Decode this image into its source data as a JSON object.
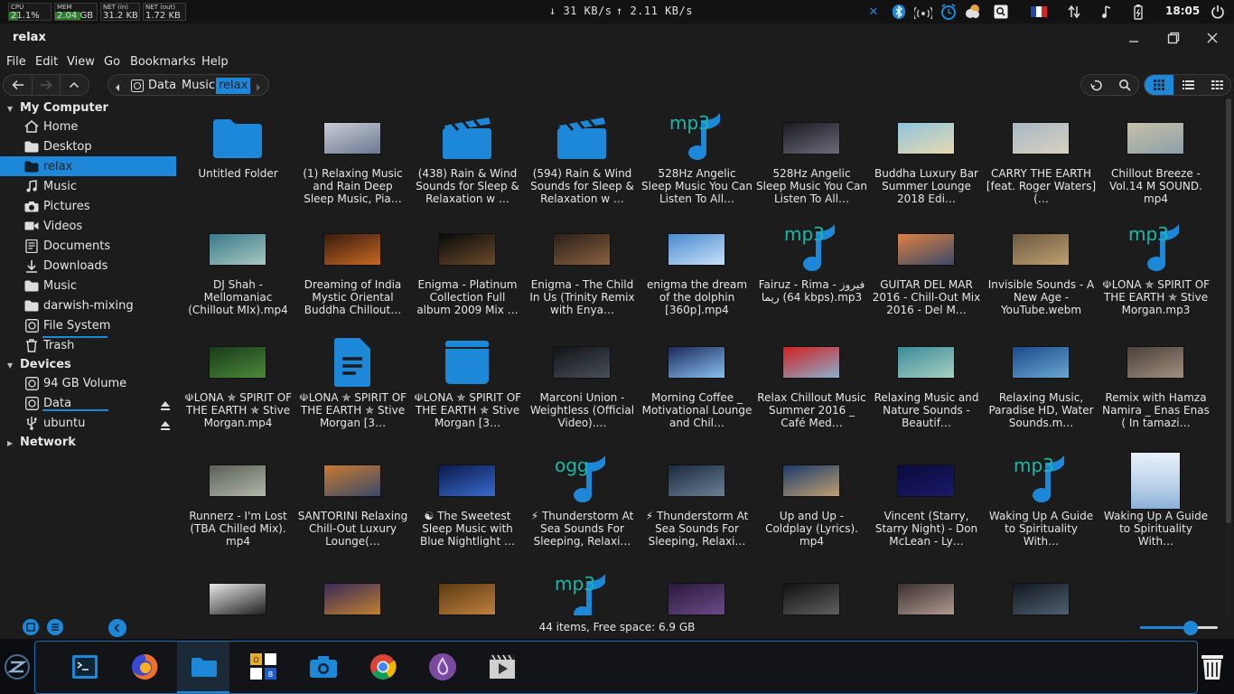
{
  "panel": {
    "cpu": {
      "label": "CPU",
      "value": "21.1%",
      "fill": 0.211
    },
    "mem": {
      "label": "MEM",
      "value": "2.04 GB",
      "fill": 0.6
    },
    "net_in": {
      "label": "NET (in)",
      "value": "31.2 KB"
    },
    "net_out": {
      "label": "NET (out)",
      "value": "1.72 KB"
    },
    "down_speed": "↓  31 KB/s",
    "up_speed": "↑ 2.11 KB/s",
    "clock": "18:05"
  },
  "window": {
    "title": "relax"
  },
  "menu": [
    "File",
    "Edit",
    "View",
    "Go",
    "Bookmarks",
    "Help"
  ],
  "breadcrumb": [
    "Data",
    "Music",
    "relax"
  ],
  "sidebar": {
    "computer_header": "My Computer",
    "computer": [
      {
        "label": "Home",
        "icon": "home-icon"
      },
      {
        "label": "Desktop",
        "icon": "folder-icon"
      },
      {
        "label": "relax",
        "icon": "folder-icon",
        "selected": true
      },
      {
        "label": "Music",
        "icon": "music-icon"
      },
      {
        "label": "Pictures",
        "icon": "camera-icon"
      },
      {
        "label": "Videos",
        "icon": "video-icon"
      },
      {
        "label": "Documents",
        "icon": "document-icon"
      },
      {
        "label": "Downloads",
        "icon": "download-icon"
      },
      {
        "label": "Music",
        "icon": "folder-icon"
      },
      {
        "label": "darwish-mixing",
        "icon": "folder-icon"
      },
      {
        "label": "File System",
        "icon": "drive-icon"
      },
      {
        "label": "Trash",
        "icon": "trash-icon"
      }
    ],
    "devices_header": "Devices",
    "devices": [
      {
        "label": "94 GB Volume",
        "icon": "drive-icon"
      },
      {
        "label": "Data",
        "icon": "drive-icon"
      },
      {
        "label": "ubuntu",
        "icon": "usb-icon"
      }
    ],
    "network_header": "Network"
  },
  "files": [
    {
      "name": "Untitled Folder",
      "type": "folder"
    },
    {
      "name": "(1) Relaxing Music and Rain Deep Sleep Music, Pia…",
      "type": "photo",
      "colors": [
        "#c8ccd6",
        "#6c7890"
      ]
    },
    {
      "name": "(438) Rain & Wind Sounds for Sleep & Relaxation w …",
      "type": "video"
    },
    {
      "name": "(594) Rain & Wind Sounds for Sleep & Relaxation w …",
      "type": "video"
    },
    {
      "name": "528Hz Angelic Sleep Music You Can Listen To All…",
      "type": "audio",
      "ext": "mp3"
    },
    {
      "name": "528Hz Angelic Sleep Music You Can Listen To All…",
      "type": "photo",
      "colors": [
        "#1a1a22",
        "#6c6c7a"
      ]
    },
    {
      "name": "Buddha Luxury Bar Summer Lounge 2018 Edi…",
      "type": "photo",
      "colors": [
        "#8ec4dc",
        "#e8d8b0"
      ]
    },
    {
      "name": "CARRY THE EARTH [feat. Roger Waters] (…",
      "type": "photo",
      "colors": [
        "#a8b8c4",
        "#d8d0c0"
      ]
    },
    {
      "name": "Chillout Breeze - Vol.14 M SOUND. mp4",
      "type": "photo",
      "colors": [
        "#c8c0a8",
        "#8aa0a8"
      ]
    },
    {
      "name": "DJ Shah - Mellomaniac (Chillout MIx).mp4",
      "type": "photo",
      "colors": [
        "#3a7a8a",
        "#a8c8c0"
      ]
    },
    {
      "name": "Dreaming of India Mystic Oriental Buddha Chillout…",
      "type": "photo",
      "colors": [
        "#3a1a10",
        "#c86a20"
      ]
    },
    {
      "name": "Enigma - Platinum Collection Full album 2009 Mix …",
      "type": "photo",
      "colors": [
        "#0a0a0a",
        "#6a4a2a"
      ]
    },
    {
      "name": "Enigma - The Child In Us (Trinity Remix with Enya…",
      "type": "photo",
      "colors": [
        "#2a2018",
        "#8a6040"
      ]
    },
    {
      "name": "enigma the dream of the dolphin [360p].mp4",
      "type": "photo",
      "colors": [
        "#4a8ad0",
        "#c8e0f8"
      ]
    },
    {
      "name": "Fairuz - Rima فيروز - ريما (64 kbps).mp3",
      "type": "audio",
      "ext": "mp3"
    },
    {
      "name": "GUITAR DEL MAR 2016 - Chill-Out Mix 2016 - Del M…",
      "type": "photo",
      "colors": [
        "#e08040",
        "#3a4a6a"
      ]
    },
    {
      "name": "Invisible Sounds - A New Age - YouTube.webm",
      "type": "photo",
      "colors": [
        "#6a5a40",
        "#c0a070"
      ]
    },
    {
      "name": "☫LONA ✯ SPIRIT OF THE EARTH ✯ Stive Morgan.mp3",
      "type": "audio",
      "ext": "mp3"
    },
    {
      "name": "☫LONA ✯ SPIRIT OF THE EARTH ✯ Stive Morgan.mp4",
      "type": "photo",
      "colors": [
        "#1a3a1a",
        "#4a8a3a"
      ]
    },
    {
      "name": "☫LONA ✯ SPIRIT OF THE EARTH ✯ Stive Morgan [3…",
      "type": "text"
    },
    {
      "name": "☫LONA ✯ SPIRIT OF THE EARTH ✯ Stive Morgan [3…",
      "type": "generic"
    },
    {
      "name": "Marconi Union - Weightless (Official Video).…",
      "type": "photo",
      "colors": [
        "#101418",
        "#4a5058"
      ]
    },
    {
      "name": "Morning Coffee _ Motivational Lounge and Chil…",
      "type": "photo",
      "colors": [
        "#1a2a5a",
        "#8ac0f0"
      ]
    },
    {
      "name": "Relax Chillout Music Summer 2016 _ Café Med…",
      "type": "photo",
      "colors": [
        "#d02020",
        "#8ab0d0"
      ]
    },
    {
      "name": "Relaxing Music and Nature Sounds - Beautif…",
      "type": "photo",
      "colors": [
        "#3a8a9a",
        "#a8d0c0"
      ]
    },
    {
      "name": "Relaxing Music, Paradise HD, Water Sounds.m…",
      "type": "photo",
      "colors": [
        "#1a4a8a",
        "#6aa8d0"
      ]
    },
    {
      "name": "Remix with Hamza Namira _ Enas Enas ( In tamazi…",
      "type": "photo",
      "colors": [
        "#4a4038",
        "#a09080"
      ]
    },
    {
      "name": "Runnerz - I'm Lost (TBA Chilled Mix). mp4",
      "type": "photo",
      "colors": [
        "#5a6058",
        "#b0b8a8"
      ]
    },
    {
      "name": "SANTORINI Relaxing Chill-Out Luxury Lounge(…",
      "type": "photo",
      "colors": [
        "#c87a30",
        "#3a4a6a"
      ]
    },
    {
      "name": "☯ The Sweetest Sleep Music with Blue Nightlight …",
      "type": "photo",
      "colors": [
        "#0a1a4a",
        "#3a6ad0"
      ]
    },
    {
      "name": "⚡ Thunderstorm At Sea Sounds For Sleeping, Relaxi…",
      "type": "audio",
      "ext": "ogg"
    },
    {
      "name": "⚡ Thunderstorm At Sea Sounds For Sleeping, Relaxi…",
      "type": "photo",
      "colors": [
        "#1a2a3a",
        "#6a8098"
      ]
    },
    {
      "name": "Up and Up - Coldplay (Lyrics). mp4",
      "type": "photo",
      "colors": [
        "#1a3a6a",
        "#c0a070"
      ]
    },
    {
      "name": "Vincent (Starry, Starry Night) - Don McLean - Ly…",
      "type": "photo",
      "colors": [
        "#0a0a3a",
        "#1a1a6a"
      ]
    },
    {
      "name": "Waking Up A Guide to Spirituality With…",
      "type": "audio",
      "ext": "mp3"
    },
    {
      "name": "Waking Up A Guide to Spirituality With…",
      "type": "book"
    },
    {
      "name": "",
      "type": "photo",
      "colors": [
        "#e8e8e8",
        "#202020"
      ]
    },
    {
      "name": "",
      "type": "photo",
      "colors": [
        "#3a2a5a",
        "#c08030"
      ]
    },
    {
      "name": "",
      "type": "photo",
      "colors": [
        "#5a3a10",
        "#c08040"
      ]
    },
    {
      "name": "",
      "type": "audio",
      "ext": "mp3"
    },
    {
      "name": "",
      "type": "photo",
      "colors": [
        "#2a1a3a",
        "#6a4a8a"
      ]
    },
    {
      "name": "",
      "type": "photo",
      "colors": [
        "#101010",
        "#606060"
      ]
    },
    {
      "name": "",
      "type": "photo",
      "colors": [
        "#3a3030",
        "#b09a90"
      ]
    },
    {
      "name": "",
      "type": "photo",
      "colors": [
        "#101820",
        "#506070"
      ]
    }
  ],
  "status": "44 items, Free space: 6.9 GB",
  "zoom_level": 0.65,
  "accent": "#1e88d8",
  "dock": [
    "terminal-icon",
    "firefox-icon",
    "files-icon",
    "todo-icon",
    "screenshot-icon",
    "chrome-icon",
    "media-player-icon",
    "video-editor-icon"
  ]
}
